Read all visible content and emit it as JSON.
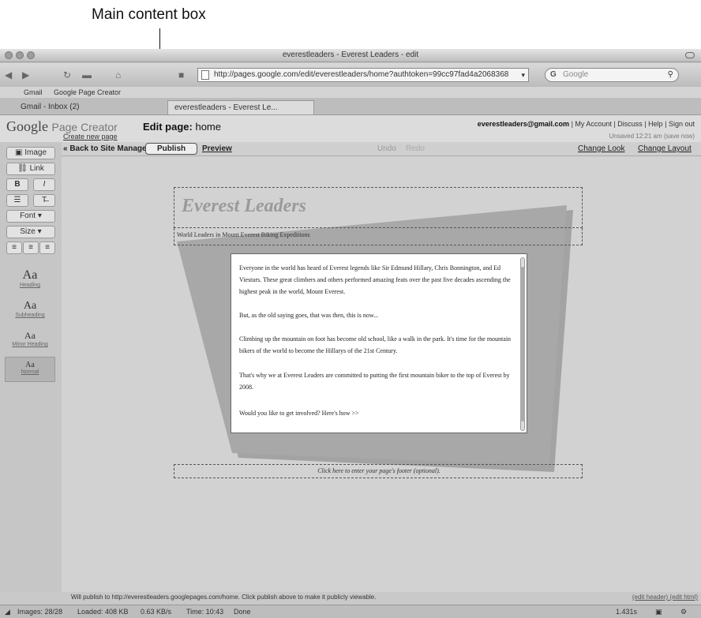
{
  "callout": {
    "label": "Main content box"
  },
  "window": {
    "title": "everestleaders - Everest Leaders - edit"
  },
  "browser": {
    "url": "http://pages.google.com/edit/everestleaders/home?authtoken=99cc97fad4a2068368",
    "search_placeholder": "Google",
    "bookmarks": [
      "Gmail",
      "Google Page Creator"
    ],
    "tabs": [
      "Gmail - Inbox (2)",
      "everestleaders - Everest Le..."
    ]
  },
  "app": {
    "logo_google": "Google",
    "logo_product": "Page Creator",
    "edit_label": "Edit page:",
    "page_name": "home",
    "create_new": "Create new page",
    "account_email": "everestleaders@gmail.com",
    "account_links": "| My Account | Discuss | Help | Sign out",
    "unsaved": "Unsaved 12:21 am (save now)"
  },
  "toolbar": {
    "back": "« Back to Site Manager",
    "publish": "Publish",
    "preview": "Preview",
    "undo": "Undo",
    "redo": "Redo",
    "change_look": "Change Look",
    "change_layout": "Change Layout"
  },
  "sidebar": {
    "image": "Image",
    "link": "Link",
    "bold": "B",
    "italic": "I",
    "font": "Font",
    "size": "Size",
    "styles": [
      {
        "sample": "Aa",
        "caption": "Heading"
      },
      {
        "sample": "Aa",
        "caption": "Subheading"
      },
      {
        "sample": "Aa",
        "caption": "Minor Heading"
      },
      {
        "sample": "Aa",
        "caption": "Normal"
      }
    ]
  },
  "page": {
    "site_title": "Everest Leaders",
    "tagline": "World Leaders in Mount Everest Biking Expeditions",
    "paragraphs": [
      "Everyone in the world has heard of Everest legends like Sir Edmund Hillary, Chris Bonnington, and Ed Viesturs. These great climbers and others performed amazing feats over the past five decades ascending the highest peak in the world, Mount Everest.",
      "But, as the old saying goes, that was then, this is now...",
      "Climbing up the mountain on foot has become old school, like a walk in the park. It's time for the mountain bikers of the world to become the Hillarys of the 21st Century.",
      "That's why we at Everest Leaders are committed to putting the first mountain biker to the top of Everest by 2008.",
      "Would you like to get involved?  Here's how >>"
    ],
    "footer_hint": "Click here to enter your page's footer (optional).",
    "publish_note": "Will publish to http://everestleaders.googlepages.com/home. Click publish above to make it publicly viewable.",
    "publish_right": "(edit header) (edit html)"
  },
  "status": {
    "images": "Images: 28/28",
    "loaded": "Loaded: 408 KB",
    "speed": "0.63 KB/s",
    "time": "Time: 10:43",
    "done": "Done",
    "right": "1.431s"
  },
  "colors": {
    "backdrop_trapezoid": "#a8a8a8",
    "shadow": "#7c7c7c"
  }
}
